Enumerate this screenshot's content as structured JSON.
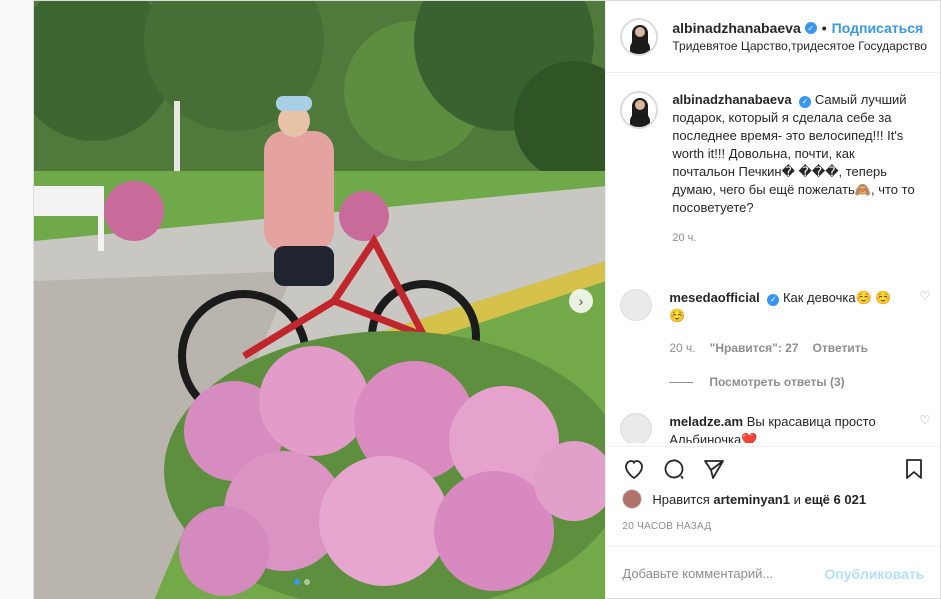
{
  "header": {
    "username": "albinadzhanabaeva",
    "separator": "•",
    "follow_label": "Подписаться",
    "location": "Тридевятое Царство,тридесятое Государство"
  },
  "caption": {
    "username": "albinadzhanabaeva",
    "text": "Самый лучший подарок, который я сделала себе за последнее время- это велосипед!!! It's worth it!!! Довольна, почти, как почтальон Печкин� ���, теперь думаю, чего бы ещё пожелать🙈, что то посоветуете?",
    "time": "20 ч."
  },
  "comments": [
    {
      "username": "mesedaofficial",
      "text": "Как девочка☺️ ☺️☺️",
      "time": "20 ч.",
      "likes": "\"Нравится\": 27",
      "reply_label": "Ответить",
      "view_replies": "Посмотреть ответы (3)"
    },
    {
      "username": "meladze.am",
      "text": "Вы красавица просто Альбиночка❤️"
    }
  ],
  "likes": {
    "prefix": "Нравится",
    "user": "arteminyan1",
    "middle": "и",
    "others": "ещё 6 021"
  },
  "timestamp": "20 ЧАСОВ НАЗАД",
  "add_comment": {
    "placeholder": "Добавьте комментарий...",
    "publish_label": "Опубликовать"
  },
  "icons": {
    "verified": "verified-badge-icon",
    "like": "heart-icon",
    "comment": "comment-icon",
    "share": "share-icon",
    "save": "bookmark-icon",
    "next": "chevron-right-icon"
  },
  "colors": {
    "accent": "#3897f0",
    "muted": "#8e8e8e",
    "publish_disabled": "#b2dffc"
  }
}
